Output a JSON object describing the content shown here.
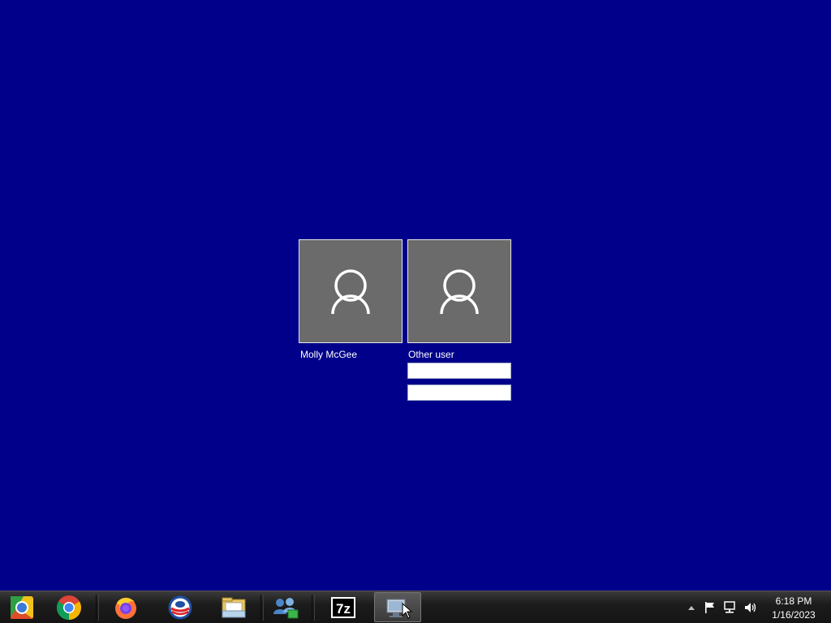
{
  "login": {
    "users": [
      {
        "name": "Molly McGee"
      },
      {
        "name": "Other user"
      }
    ],
    "username_field": {
      "value": "",
      "placeholder": ""
    },
    "password_field": {
      "value": "",
      "placeholder": ""
    }
  },
  "taskbar": {
    "apps": [
      {
        "icon": "chromium-icon"
      },
      {
        "icon": "chrome-icon"
      },
      {
        "icon": "firefox-icon"
      },
      {
        "icon": "opera-icon"
      },
      {
        "icon": "file-explorer-icon"
      },
      {
        "icon": "network-sharing-icon"
      },
      {
        "icon": "7zip-icon",
        "label": "7z"
      },
      {
        "icon": "remote-desktop-icon",
        "active": true
      }
    ],
    "tray": {
      "icons": [
        "show-hidden-icons-arrow",
        "action-center-flag-icon",
        "network-icon",
        "volume-icon"
      ],
      "time": "6:18 PM",
      "date": "1/16/2023"
    }
  },
  "colors": {
    "desktop_bg": "#00008a",
    "tile_bg": "#6b6b6b",
    "tile_border": "#e6e6e6",
    "taskbar_bg": "#1c1c1c"
  }
}
